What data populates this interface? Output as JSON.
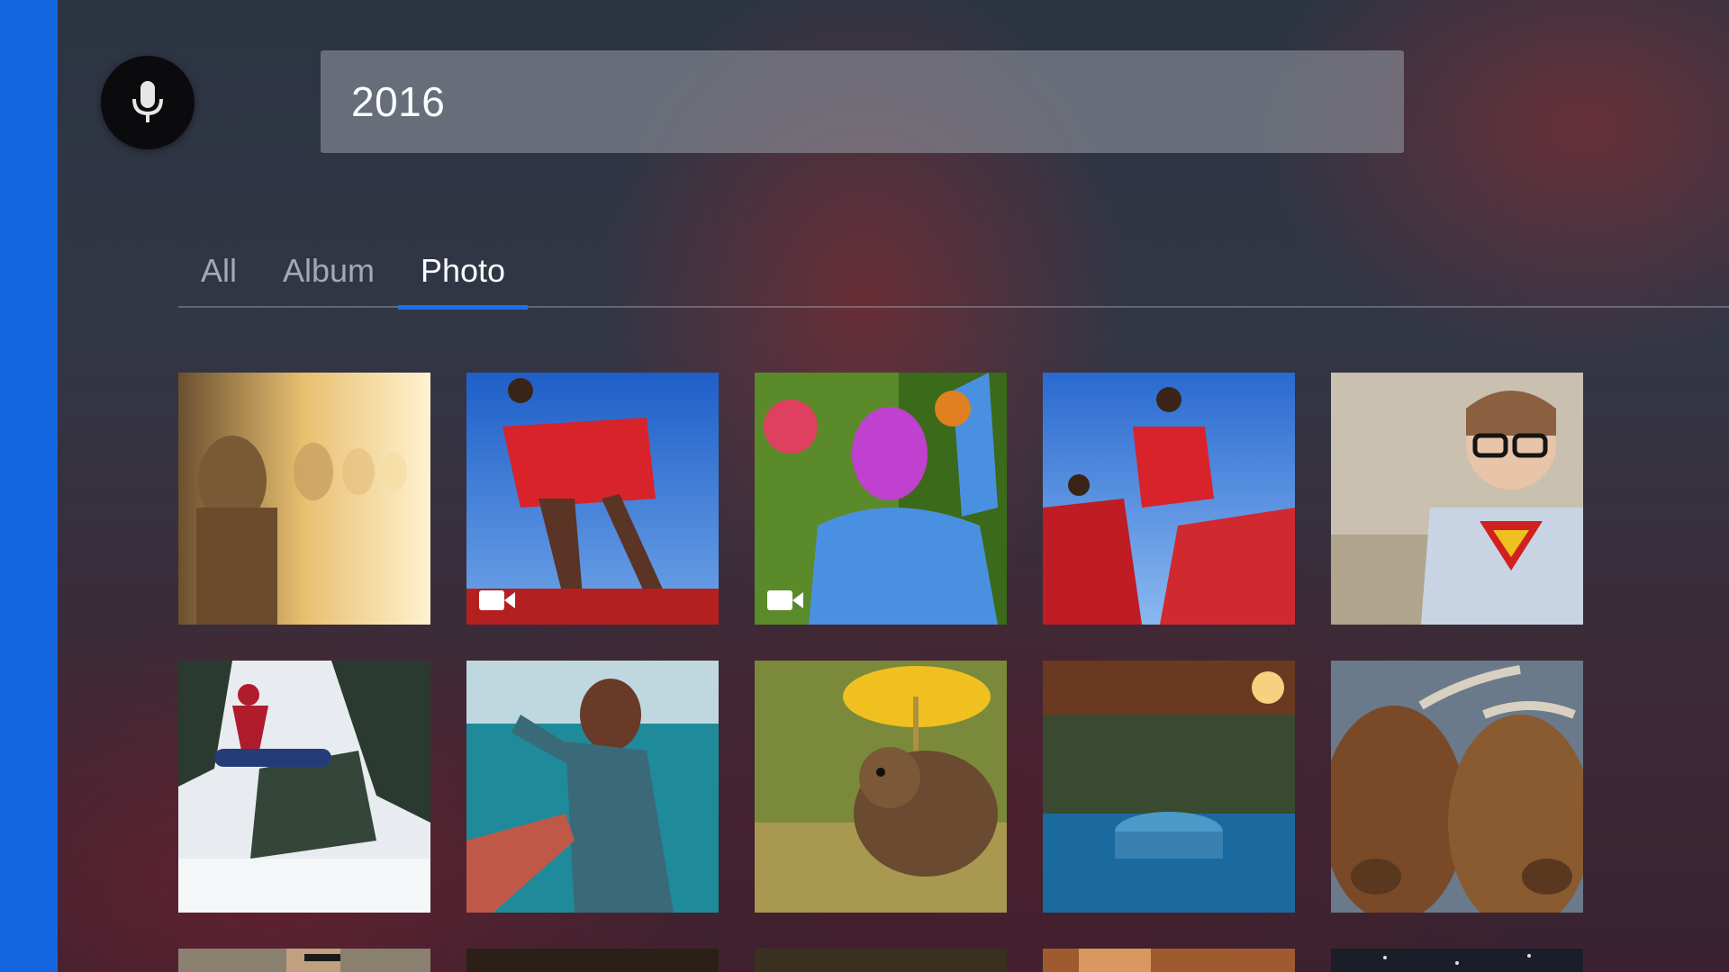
{
  "search": {
    "query": "2016"
  },
  "voice_button": {
    "icon": "microphone-icon"
  },
  "tabs": [
    {
      "label": "All",
      "active": false
    },
    {
      "label": "Album",
      "active": false
    },
    {
      "label": "Photo",
      "active": true
    }
  ],
  "photos": [
    {
      "subject": "buddha-statues",
      "video": false
    },
    {
      "subject": "maasai-jump",
      "video": true
    },
    {
      "subject": "holi-festival",
      "video": true
    },
    {
      "subject": "maasai-jump-2",
      "video": false
    },
    {
      "subject": "superman-boy",
      "video": false
    },
    {
      "subject": "snowboarder",
      "video": false
    },
    {
      "subject": "follow-me-sea",
      "video": false
    },
    {
      "subject": "squirrel-umbrella",
      "video": false
    },
    {
      "subject": "resort-pool",
      "video": false
    },
    {
      "subject": "highland-cattle",
      "video": false
    },
    {
      "subject": "partial-row",
      "video": false
    },
    {
      "subject": "partial-row",
      "video": false
    },
    {
      "subject": "partial-row",
      "video": false
    },
    {
      "subject": "partial-row",
      "video": false
    },
    {
      "subject": "partial-row",
      "video": false
    }
  ],
  "colors": {
    "accent": "#1a73ea",
    "left_bar": "#1466e0"
  }
}
